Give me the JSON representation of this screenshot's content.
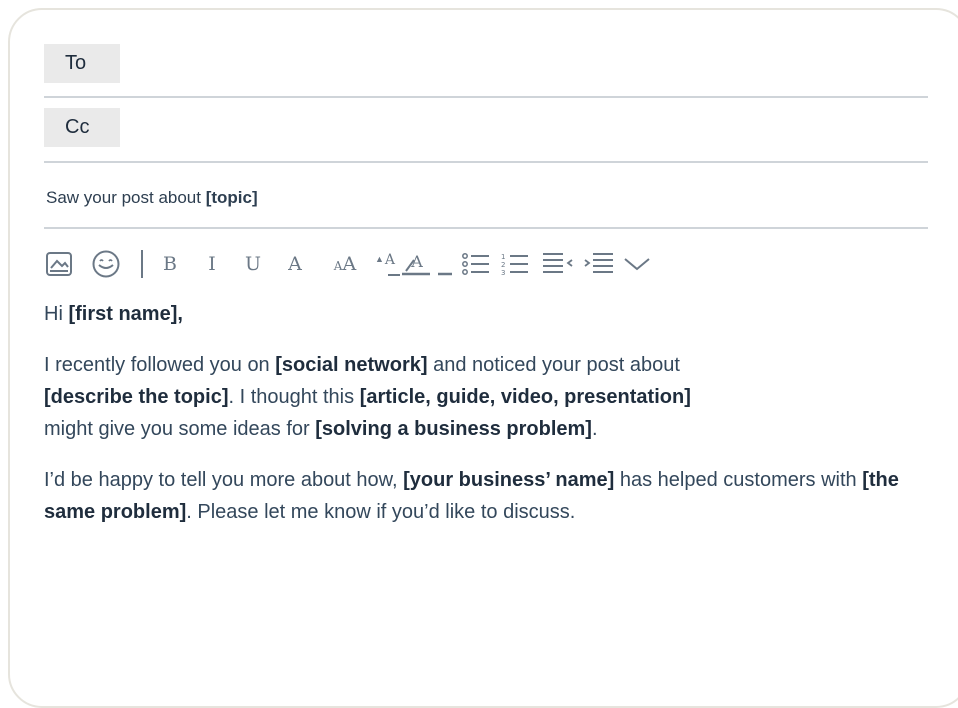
{
  "compose": {
    "to_label": "To",
    "cc_label": "Cc",
    "subject": {
      "prefix": "Saw your post about ",
      "bold": "[topic]"
    }
  },
  "toolbar": {
    "icons": [
      "image-icon",
      "emoji-icon",
      "bold-icon",
      "italic-icon",
      "underline-icon",
      "strikethrough-icon",
      "font-size-icon",
      "superscript-icon",
      "text-color-icon",
      "bulleted-list-icon",
      "numbered-list-icon",
      "outdent-icon",
      "indent-icon",
      "more-chevron-icon"
    ],
    "bold_label": "B",
    "italic_label": "I",
    "underline_label": "U",
    "strike_label": "A",
    "size_small": "A",
    "size_large": "A",
    "superscript_label": "A",
    "color_label": "A"
  },
  "body": {
    "greeting": {
      "prefix": "Hi ",
      "bold": "[first name],"
    },
    "paragraph1": {
      "s1": "I recently followed you on ",
      "b1": "[social network]",
      "s2": " and noticed your post about ",
      "b2": "[describe the topic]",
      "s3": ". I thought this ",
      "b3": "[article, guide, video, presentation]",
      "s4": " might give you some ideas for ",
      "b4": "[solving a business problem]",
      "s5": "."
    },
    "paragraph2": {
      "s1": "I’d be happy to tell you more about how, ",
      "b1": "[your business’ name]",
      "s2": " has helped customers with ",
      "b2": "[the same problem]",
      "s3": ". Please let me know if you’d like to discuss."
    }
  }
}
